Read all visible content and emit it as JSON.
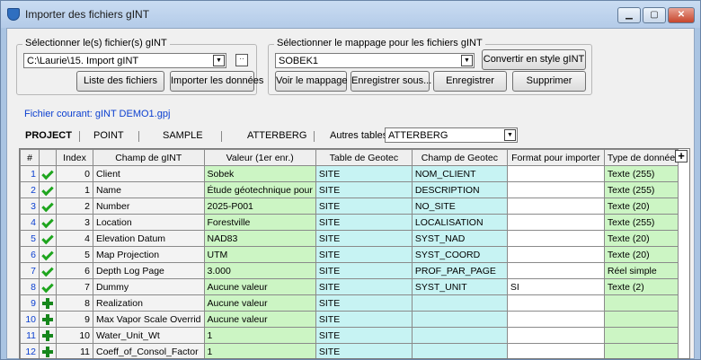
{
  "window": {
    "title": "Importer des fichiers gINT",
    "min_label": "▁",
    "max_label": "▢",
    "close_label": "✕"
  },
  "files_group": {
    "legend": "Sélectionner le(s) fichier(s) gINT",
    "path": "C:\\Laurie\\15. Import gINT",
    "browse_label": "··",
    "list_button": "Liste des fichiers",
    "import_button": "Importer les données"
  },
  "mapping_group": {
    "legend": "Sélectionner le mappage pour les fichiers gINT",
    "selected": "SOBEK1",
    "convert_button": "Convertir en style gINT",
    "view_button": "Voir le mappage",
    "save_as_button": "Enregistrer sous...",
    "save_button": "Enregistrer",
    "delete_button": "Supprimer"
  },
  "current_file": "Fichier courant: gINT DEMO1.gpj",
  "tabs": [
    "PROJECT",
    "POINT",
    "SAMPLE",
    "ATTERBERG"
  ],
  "other_tables": {
    "label": "Autres tables:",
    "selected": "ATTERBERG"
  },
  "grid": {
    "columns": [
      "#",
      "",
      "Index",
      "Champ de gINT",
      "Valeur (1er enr.)",
      "Table de Geotec",
      "Champ de Geotec",
      "Format pour importer",
      "Type de donnée"
    ],
    "plus_label": "+",
    "rows": [
      {
        "num": "1",
        "status": "check",
        "index": "0",
        "field": "Client",
        "value": "Sobek",
        "table": "SITE",
        "geofield": "NOM_CLIENT",
        "format": "",
        "type": "Texte (255)"
      },
      {
        "num": "2",
        "status": "check",
        "index": "1",
        "field": "Name",
        "value": "Étude géotechnique pour",
        "table": "SITE",
        "geofield": "DESCRIPTION",
        "format": "",
        "type": "Texte (255)"
      },
      {
        "num": "3",
        "status": "check",
        "index": "2",
        "field": "Number",
        "value": "2025-P001",
        "table": "SITE",
        "geofield": "NO_SITE",
        "format": "",
        "type": "Texte (20)"
      },
      {
        "num": "4",
        "status": "check",
        "index": "3",
        "field": "Location",
        "value": "Forestville",
        "table": "SITE",
        "geofield": "LOCALISATION",
        "format": "",
        "type": "Texte (255)"
      },
      {
        "num": "5",
        "status": "check",
        "index": "4",
        "field": "Elevation Datum",
        "value": "NAD83",
        "table": "SITE",
        "geofield": "SYST_NAD",
        "format": "",
        "type": "Texte (20)"
      },
      {
        "num": "6",
        "status": "check",
        "index": "5",
        "field": "Map Projection",
        "value": "UTM",
        "table": "SITE",
        "geofield": "SYST_COORD",
        "format": "",
        "type": "Texte (20)"
      },
      {
        "num": "7",
        "status": "check",
        "index": "6",
        "field": "Depth Log Page",
        "value": "3.000",
        "table": "SITE",
        "geofield": "PROF_PAR_PAGE",
        "format": "",
        "type": "Réel simple"
      },
      {
        "num": "8",
        "status": "check",
        "index": "7",
        "field": "Dummy",
        "value": "Aucune valeur",
        "table": "SITE",
        "geofield": "SYST_UNIT",
        "format": "SI",
        "type": "Texte (2)"
      },
      {
        "num": "9",
        "status": "plus",
        "index": "8",
        "field": "Realization",
        "value": "Aucune valeur",
        "table": "SITE",
        "geofield": "",
        "format": "",
        "type": ""
      },
      {
        "num": "10",
        "status": "plus",
        "index": "9",
        "field": "Max Vapor Scale Overrid",
        "value": "Aucune valeur",
        "table": "SITE",
        "geofield": "",
        "format": "",
        "type": ""
      },
      {
        "num": "11",
        "status": "plus",
        "index": "10",
        "field": "Water_Unit_Wt",
        "value": "1",
        "table": "SITE",
        "geofield": "",
        "format": "",
        "type": ""
      },
      {
        "num": "12",
        "status": "plus",
        "index": "11",
        "field": "Coeff_of_Consol_Factor",
        "value": "1",
        "table": "SITE",
        "geofield": "",
        "format": "",
        "type": ""
      }
    ]
  },
  "colors": {
    "accent_blue": "#0b3fd0",
    "green_cell": "#ccf5c4",
    "cyan_cell": "#c7f3f3"
  }
}
